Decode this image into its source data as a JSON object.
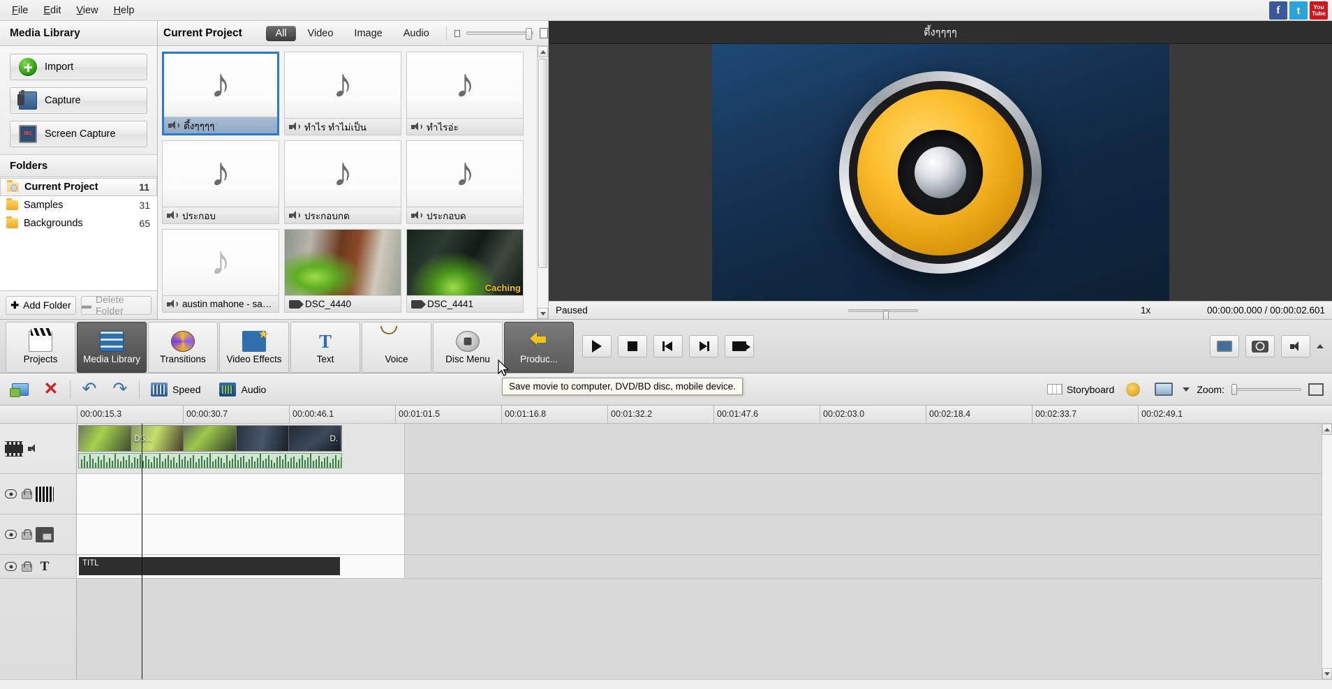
{
  "menubar": {
    "items": [
      {
        "label": "File",
        "accel": "F"
      },
      {
        "label": "Edit",
        "accel": "E"
      },
      {
        "label": "View",
        "accel": "V"
      },
      {
        "label": "Help",
        "accel": "H"
      }
    ],
    "social": [
      {
        "name": "facebook-icon",
        "glyph": "f"
      },
      {
        "name": "twitter-icon",
        "glyph": "t"
      },
      {
        "name": "youtube-icon",
        "glyph": "You Tube"
      }
    ]
  },
  "sidebar": {
    "title": "Media Library",
    "buttons": [
      {
        "label": "Import",
        "icon": "import-icon"
      },
      {
        "label": "Capture",
        "icon": "capture-icon"
      },
      {
        "label": "Screen Capture",
        "icon": "screen-capture-icon"
      }
    ],
    "folders_header": "Folders",
    "folders": [
      {
        "label": "Current Project",
        "count": "11",
        "active": true
      },
      {
        "label": "Samples",
        "count": "31",
        "active": false
      },
      {
        "label": "Backgrounds",
        "count": "65",
        "active": false
      }
    ],
    "add_folder": "Add Folder",
    "delete_folder": "Delete Folder"
  },
  "library": {
    "title": "Current Project",
    "filters": [
      {
        "label": "All",
        "active": true
      },
      {
        "label": "Video",
        "active": false
      },
      {
        "label": "Image",
        "active": false
      },
      {
        "label": "Audio",
        "active": false
      }
    ],
    "items": [
      {
        "label": "ตึ้งๆๆๆๆ",
        "type": "audio",
        "selected": true
      },
      {
        "label": "ทำไร ทำไม่เป็น",
        "type": "audio",
        "selected": false
      },
      {
        "label": "ทำไรอ่ะ",
        "type": "audio",
        "selected": false
      },
      {
        "label": "ประกอบ",
        "type": "audio",
        "selected": false
      },
      {
        "label": "ประกอบกด",
        "type": "audio",
        "selected": false
      },
      {
        "label": "ประกอบด",
        "type": "audio",
        "selected": false
      },
      {
        "label": "austin mahone - say ...",
        "type": "audio",
        "selected": false
      },
      {
        "label": "DSC_4440",
        "type": "video",
        "selected": false
      },
      {
        "label": "DSC_4441",
        "type": "video",
        "selected": false,
        "badge": "Caching"
      }
    ]
  },
  "preview": {
    "title": "ตึ้งๆๆๆๆ",
    "state": "Paused",
    "rate": "1x",
    "time_current": "00:00:00.000",
    "time_separator": "/",
    "time_total": "00:00:02.601"
  },
  "modules": [
    {
      "label": "Projects",
      "icon": "projects-icon",
      "state": "normal"
    },
    {
      "label": "Media Library",
      "icon": "media-library-icon",
      "state": "active"
    },
    {
      "label": "Transitions",
      "icon": "transitions-icon",
      "state": "normal"
    },
    {
      "label": "Video Effects",
      "icon": "video-effects-icon",
      "state": "normal"
    },
    {
      "label": "Text",
      "icon": "text-icon",
      "state": "normal"
    },
    {
      "label": "Voice",
      "icon": "voice-icon",
      "state": "normal"
    },
    {
      "label": "Disc Menu",
      "icon": "disc-menu-icon",
      "state": "normal"
    },
    {
      "label": "Produc...",
      "icon": "produce-icon",
      "state": "hover"
    }
  ],
  "tooltip": "Save movie to computer, DVD/BD disc, mobile device.",
  "timeline_toolbar": {
    "speed_label": "Speed",
    "audio_label": "Audio",
    "storyboard_label": "Storyboard",
    "zoom_label": "Zoom:"
  },
  "timeline": {
    "ruler_ticks": [
      "00:00:15.3",
      "00:00:30.7",
      "00:00:46.1",
      "00:01:01.5",
      "00:01:16.8",
      "00:01:32.2",
      "00:01:47.6",
      "00:02:03.0",
      "00:02:18.4",
      "00:02:33.7",
      "00:02:49.1"
    ],
    "clip_labels": [
      "DS...",
      "D."
    ],
    "track4_label": "TITL"
  }
}
